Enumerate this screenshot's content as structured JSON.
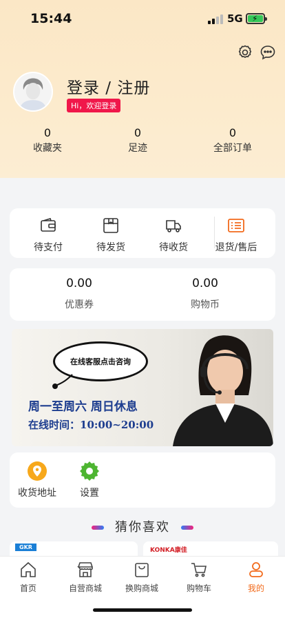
{
  "status_bar": {
    "time": "15:44",
    "network": "5G"
  },
  "profile": {
    "title": "登录 / 注册",
    "welcome": "Hi，欢迎登录"
  },
  "stats": [
    {
      "value": "0",
      "label": "收藏夹"
    },
    {
      "value": "0",
      "label": "足迹"
    },
    {
      "value": "0",
      "label": "全部订单"
    }
  ],
  "orders": [
    {
      "label": "待支付",
      "icon": "wallet-icon"
    },
    {
      "label": "待发货",
      "icon": "package-icon"
    },
    {
      "label": "待收货",
      "icon": "truck-icon"
    },
    {
      "label": "退货/售后",
      "icon": "refund-list-icon"
    }
  ],
  "wallet": [
    {
      "value": "0.00",
      "label": "优惠券"
    },
    {
      "value": "0.00",
      "label": "购物币"
    }
  ],
  "banner": {
    "bubble": "在线客服点击咨询",
    "line1": "周一至周六 周日休息",
    "line2": "在线时间：10:00~20:00"
  },
  "tools": [
    {
      "label": "收货地址",
      "icon": "location-icon"
    },
    {
      "label": "设置",
      "icon": "settings-gear-icon"
    }
  ],
  "guess_title": "猜你喜欢",
  "peek_brands": {
    "left": "GKR",
    "right": "KONKA康佳"
  },
  "tabs": [
    {
      "label": "首页",
      "icon": "home-icon"
    },
    {
      "label": "自营商城",
      "icon": "store-icon"
    },
    {
      "label": "换购商城",
      "icon": "bag-icon"
    },
    {
      "label": "购物车",
      "icon": "cart-icon"
    },
    {
      "label": "我的",
      "icon": "user-icon",
      "active": true
    }
  ],
  "colors": {
    "accent": "#f26a1b",
    "welcome_badge": "#f0174a",
    "banner_text": "#1d3d8f",
    "header_bg": "#fbe7c6"
  }
}
